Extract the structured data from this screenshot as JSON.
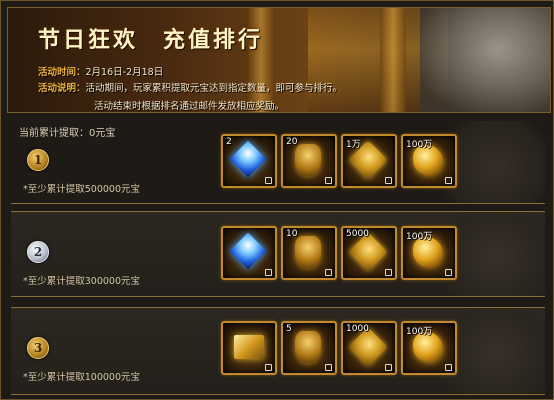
{
  "banner": {
    "title": "节日狂欢　充值排行",
    "period_label": "活动时间：",
    "period_value": "2月16日-2月18日",
    "desc_label": "活动说明：",
    "desc_line1": "活动期间，玩家累积提取元宝达到指定数量，即可参与排行。",
    "desc_line2": "活动结束时根据排名通过邮件发放相应奖励。"
  },
  "current_total": {
    "label": "当前累计提取：",
    "value": "0元宝"
  },
  "tiers": [
    {
      "rank": "1",
      "requirement": "*至少累计提取500000元宝",
      "rewards": [
        {
          "icon": "gem-icon",
          "qty": "2"
        },
        {
          "icon": "armor-icon",
          "qty": "20"
        },
        {
          "icon": "coin-icon",
          "qty": "1万"
        },
        {
          "icon": "gold-ingot-icon",
          "qty": "100万"
        }
      ]
    },
    {
      "rank": "2",
      "requirement": "*至少累计提取300000元宝",
      "rewards": [
        {
          "icon": "gem-icon",
          "qty": ""
        },
        {
          "icon": "armor-icon",
          "qty": "10"
        },
        {
          "icon": "coin-icon",
          "qty": "5000"
        },
        {
          "icon": "gold-ingot-icon",
          "qty": "100万"
        }
      ]
    },
    {
      "rank": "3",
      "requirement": "*至少累计提取100000元宝",
      "rewards": [
        {
          "icon": "treasure-box-icon",
          "qty": ""
        },
        {
          "icon": "armor-icon",
          "qty": "5"
        },
        {
          "icon": "coin-icon",
          "qty": "1000"
        },
        {
          "icon": "gold-ingot-icon",
          "qty": "100万"
        }
      ]
    }
  ],
  "colors": {
    "gold_border": "#c28a2a",
    "label_orange": "#f0b43a",
    "panel_bg": "#23201b"
  }
}
